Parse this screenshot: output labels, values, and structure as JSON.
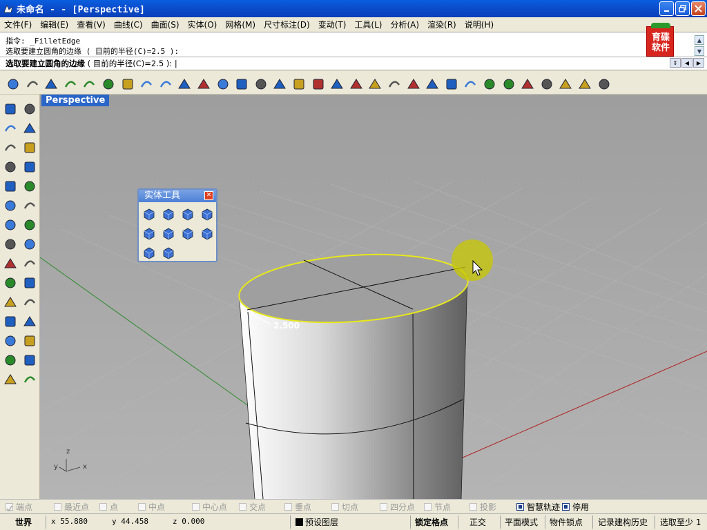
{
  "window": {
    "title": "未命名 - - [Perspective]",
    "buttons": [
      "minimize",
      "restore",
      "close"
    ]
  },
  "menu": [
    "文件(F)",
    "编辑(E)",
    "查看(V)",
    "曲线(C)",
    "曲面(S)",
    "实体(O)",
    "网格(M)",
    "尺寸标注(D)",
    "变动(T)",
    "工具(L)",
    "分析(A)",
    "渲染(R)",
    "说明(H)"
  ],
  "command": {
    "history": [
      "指令: _FilletEdge",
      "选取要建立圆角的边缘 ( 目前的半径(C)=2.5 ):"
    ],
    "prompt_bold": "选取要建立圆角的边缘",
    "prompt_rest": " ( 目前的半径(C)=2.5 ): |"
  },
  "logo": {
    "text": "育碟软件"
  },
  "toolbar_icons": [
    "new-icon",
    "open-icon",
    "save-icon",
    "print-icon",
    "import-icon",
    "cut-icon",
    "copy-icon",
    "paste-icon",
    "undo-icon",
    "pan-icon",
    "rotate-view-icon",
    "zoom-window-icon",
    "zoom-dynamic-icon",
    "zoom-extents-icon",
    "zoom-selected-icon",
    "undo-view-icon",
    "four-viewports-icon",
    "car-icon",
    "cplane-icon",
    "osnap-icon",
    "grid-snap-icon",
    "light-icon",
    "lock-icon",
    "layer-icon",
    "color-icon",
    "wireframe-icon",
    "shaded-icon",
    "render-icon",
    "point-icon",
    "gear-icon",
    "properties-icon",
    "help-icon"
  ],
  "left_tools": [
    "select-icon",
    "point-icon",
    "polyline-icon",
    "curve-icon",
    "circle-icon",
    "ellipse-icon",
    "arc-icon",
    "rectangle-icon",
    "polygon-icon",
    "freeform-icon",
    "surface-icon",
    "loft-icon",
    "box-icon",
    "sphere-icon",
    "cylinder-icon",
    "patch-icon",
    "transform-icon",
    "explode-icon",
    "trim-icon",
    "split-icon",
    "boolean-icon",
    "group-icon",
    "fillet-curve-icon",
    "offset-icon",
    "text-icon",
    "dimension-icon",
    "array-icon",
    "project-icon",
    "block-icon",
    "analyze-icon"
  ],
  "viewport": {
    "label": "Perspective",
    "radius_label": "2.500",
    "axis_x": "x",
    "axis_y": "y",
    "axis_z": "z"
  },
  "palette": {
    "title": "实体工具",
    "buttons": [
      "boolean-union-icon",
      "boolean-difference-icon",
      "boolean-intersection-icon",
      "boolean-split-icon",
      "cap-holes-icon",
      "extract-surface-icon",
      "fillet-edge-icon",
      "shell-icon",
      "chamfer-edge-icon",
      "solid-edit-icon"
    ]
  },
  "osnap": [
    {
      "label": "端点",
      "checked": true,
      "active": false
    },
    {
      "label": "最近点",
      "checked": false,
      "active": false
    },
    {
      "label": "点",
      "checked": false,
      "active": false
    },
    {
      "label": "中点",
      "checked": false,
      "active": false
    },
    {
      "label": "中心点",
      "checked": false,
      "active": false
    },
    {
      "label": "交点",
      "checked": false,
      "active": false
    },
    {
      "label": "垂点",
      "checked": false,
      "active": false
    },
    {
      "label": "切点",
      "checked": false,
      "active": false
    },
    {
      "label": "四分点",
      "checked": false,
      "active": false
    },
    {
      "label": "节点",
      "checked": false,
      "active": false
    },
    {
      "label": "投影",
      "checked": false,
      "active": false
    },
    {
      "label": "智慧轨迹",
      "checked": true,
      "active": false
    },
    {
      "label": "停用",
      "checked": true,
      "active": true
    }
  ],
  "status": {
    "cplane": "世界",
    "x": "x 55.880",
    "y": "y 44.458",
    "z": "z 0.000",
    "layer": "预设图层",
    "grid_snap": "锁定格点",
    "ortho": "正交",
    "planar": "平面模式",
    "osnap": "物件锁点",
    "history": "记录建构历史",
    "filter": "选取至少 1"
  }
}
